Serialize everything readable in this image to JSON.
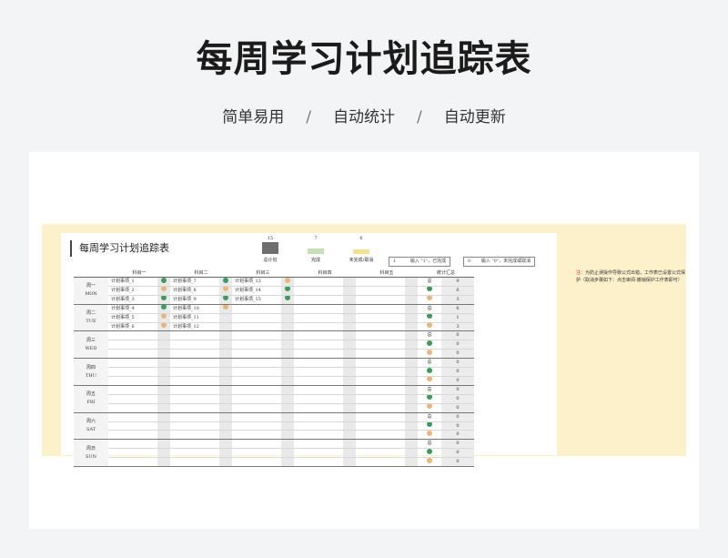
{
  "header": {
    "title": "每周学习计划追踪表",
    "features": [
      "简单易用",
      "自动统计",
      "自动更新"
    ],
    "separator": "/"
  },
  "sheet": {
    "title": "每周学习计划追踪表",
    "stats": [
      {
        "value": "15",
        "label": "总计划",
        "color": "#6f6f6f",
        "level": 1.0
      },
      {
        "value": "7",
        "label": "完成",
        "color": "#c6dfb4",
        "level": 0.47
      },
      {
        "value": "6",
        "label": "未完成/取消",
        "color": "#f4e08e",
        "level": 0.4
      }
    ],
    "legend": [
      {
        "key": "1",
        "text": "输入 \"1\"，已完成"
      },
      {
        "key": "0",
        "text": "输入 \"0\"，未完成或取消"
      }
    ],
    "columns": [
      "科目一",
      "科目二",
      "科目三",
      "科目四",
      "科目五",
      "统计汇总"
    ],
    "days": [
      {
        "cn": "周一",
        "en": "MON",
        "rows": [
          [
            "计划事项_1",
            "done",
            "计划事项_7",
            "done",
            "计划事项_13",
            "pend"
          ],
          [
            "计划事项_2",
            "pend",
            "计划事项_8",
            "pend",
            "计划事项_14",
            "done"
          ],
          [
            "计划事项_3",
            "done",
            "计划事项_9",
            "done",
            "计划事项_15",
            "done"
          ]
        ],
        "summary": [
          "9",
          "6",
          "3"
        ]
      },
      {
        "cn": "周二",
        "en": "TUE",
        "rows": [
          [
            "计划事项_4",
            "done",
            "计划事项_10",
            "pend",
            "",
            ""
          ],
          [
            "计划事项_5",
            "pend",
            "计划事项_11",
            "",
            "",
            ""
          ],
          [
            "计划事项_6",
            "pend",
            "计划事项_12",
            "",
            "",
            ""
          ]
        ],
        "summary": [
          "6",
          "1",
          "3"
        ]
      },
      {
        "cn": "周三",
        "en": "WED",
        "rows": [
          [
            "",
            "",
            "",
            "",
            "",
            ""
          ],
          [
            "",
            "",
            "",
            "",
            "",
            ""
          ],
          [
            "",
            "",
            "",
            "",
            "",
            ""
          ]
        ],
        "summary": [
          "0",
          "0",
          "0"
        ]
      },
      {
        "cn": "周四",
        "en": "THU",
        "rows": [
          [
            "",
            "",
            "",
            "",
            "",
            ""
          ],
          [
            "",
            "",
            "",
            "",
            "",
            ""
          ],
          [
            "",
            "",
            "",
            "",
            "",
            ""
          ]
        ],
        "summary": [
          "0",
          "0",
          "0"
        ]
      },
      {
        "cn": "周五",
        "en": "FRI",
        "rows": [
          [
            "",
            "",
            "",
            "",
            "",
            ""
          ],
          [
            "",
            "",
            "",
            "",
            "",
            ""
          ],
          [
            "",
            "",
            "",
            "",
            "",
            ""
          ]
        ],
        "summary": [
          "0",
          "0",
          "0"
        ]
      },
      {
        "cn": "周六",
        "en": "SAT",
        "rows": [
          [
            "",
            "",
            "",
            "",
            "",
            ""
          ],
          [
            "",
            "",
            "",
            "",
            "",
            ""
          ],
          [
            "",
            "",
            "",
            "",
            "",
            ""
          ]
        ],
        "summary": [
          "0",
          "0",
          "0"
        ]
      },
      {
        "cn": "周日",
        "en": "SUN",
        "rows": [
          [
            "",
            "",
            "",
            "",
            "",
            ""
          ],
          [
            "",
            "",
            "",
            "",
            "",
            ""
          ],
          [
            "",
            "",
            "",
            "",
            "",
            ""
          ]
        ],
        "summary": [
          "0",
          "0",
          "0"
        ]
      }
    ],
    "summary_labels": [
      "总",
      "done",
      "pend"
    ]
  },
  "note": {
    "prefix": "注：",
    "text": "为防止误操作导致公式出错，工作表已设置公式保护（取消步骤如下：点击审阅-撤销保护工作表即可）"
  },
  "colors": {
    "done": "#3f9a5d",
    "pending": "#e8b67a",
    "band": "#fdf1cc"
  }
}
